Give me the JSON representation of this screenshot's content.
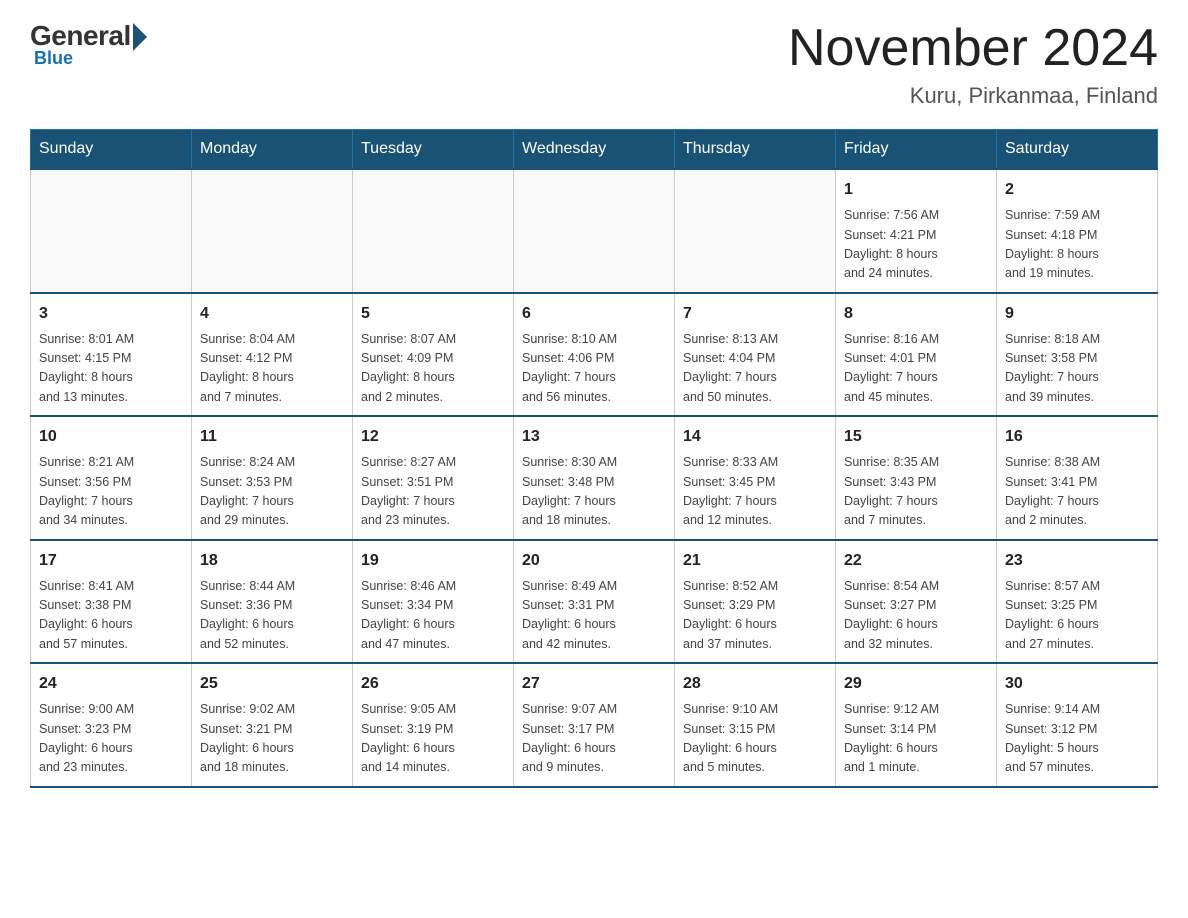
{
  "logo": {
    "general": "General",
    "blue_text": "Blue"
  },
  "header": {
    "month_year": "November 2024",
    "location": "Kuru, Pirkanmaa, Finland"
  },
  "days_of_week": [
    "Sunday",
    "Monday",
    "Tuesday",
    "Wednesday",
    "Thursday",
    "Friday",
    "Saturday"
  ],
  "weeks": [
    [
      {
        "day": "",
        "info": ""
      },
      {
        "day": "",
        "info": ""
      },
      {
        "day": "",
        "info": ""
      },
      {
        "day": "",
        "info": ""
      },
      {
        "day": "",
        "info": ""
      },
      {
        "day": "1",
        "info": "Sunrise: 7:56 AM\nSunset: 4:21 PM\nDaylight: 8 hours\nand 24 minutes."
      },
      {
        "day": "2",
        "info": "Sunrise: 7:59 AM\nSunset: 4:18 PM\nDaylight: 8 hours\nand 19 minutes."
      }
    ],
    [
      {
        "day": "3",
        "info": "Sunrise: 8:01 AM\nSunset: 4:15 PM\nDaylight: 8 hours\nand 13 minutes."
      },
      {
        "day": "4",
        "info": "Sunrise: 8:04 AM\nSunset: 4:12 PM\nDaylight: 8 hours\nand 7 minutes."
      },
      {
        "day": "5",
        "info": "Sunrise: 8:07 AM\nSunset: 4:09 PM\nDaylight: 8 hours\nand 2 minutes."
      },
      {
        "day": "6",
        "info": "Sunrise: 8:10 AM\nSunset: 4:06 PM\nDaylight: 7 hours\nand 56 minutes."
      },
      {
        "day": "7",
        "info": "Sunrise: 8:13 AM\nSunset: 4:04 PM\nDaylight: 7 hours\nand 50 minutes."
      },
      {
        "day": "8",
        "info": "Sunrise: 8:16 AM\nSunset: 4:01 PM\nDaylight: 7 hours\nand 45 minutes."
      },
      {
        "day": "9",
        "info": "Sunrise: 8:18 AM\nSunset: 3:58 PM\nDaylight: 7 hours\nand 39 minutes."
      }
    ],
    [
      {
        "day": "10",
        "info": "Sunrise: 8:21 AM\nSunset: 3:56 PM\nDaylight: 7 hours\nand 34 minutes."
      },
      {
        "day": "11",
        "info": "Sunrise: 8:24 AM\nSunset: 3:53 PM\nDaylight: 7 hours\nand 29 minutes."
      },
      {
        "day": "12",
        "info": "Sunrise: 8:27 AM\nSunset: 3:51 PM\nDaylight: 7 hours\nand 23 minutes."
      },
      {
        "day": "13",
        "info": "Sunrise: 8:30 AM\nSunset: 3:48 PM\nDaylight: 7 hours\nand 18 minutes."
      },
      {
        "day": "14",
        "info": "Sunrise: 8:33 AM\nSunset: 3:45 PM\nDaylight: 7 hours\nand 12 minutes."
      },
      {
        "day": "15",
        "info": "Sunrise: 8:35 AM\nSunset: 3:43 PM\nDaylight: 7 hours\nand 7 minutes."
      },
      {
        "day": "16",
        "info": "Sunrise: 8:38 AM\nSunset: 3:41 PM\nDaylight: 7 hours\nand 2 minutes."
      }
    ],
    [
      {
        "day": "17",
        "info": "Sunrise: 8:41 AM\nSunset: 3:38 PM\nDaylight: 6 hours\nand 57 minutes."
      },
      {
        "day": "18",
        "info": "Sunrise: 8:44 AM\nSunset: 3:36 PM\nDaylight: 6 hours\nand 52 minutes."
      },
      {
        "day": "19",
        "info": "Sunrise: 8:46 AM\nSunset: 3:34 PM\nDaylight: 6 hours\nand 47 minutes."
      },
      {
        "day": "20",
        "info": "Sunrise: 8:49 AM\nSunset: 3:31 PM\nDaylight: 6 hours\nand 42 minutes."
      },
      {
        "day": "21",
        "info": "Sunrise: 8:52 AM\nSunset: 3:29 PM\nDaylight: 6 hours\nand 37 minutes."
      },
      {
        "day": "22",
        "info": "Sunrise: 8:54 AM\nSunset: 3:27 PM\nDaylight: 6 hours\nand 32 minutes."
      },
      {
        "day": "23",
        "info": "Sunrise: 8:57 AM\nSunset: 3:25 PM\nDaylight: 6 hours\nand 27 minutes."
      }
    ],
    [
      {
        "day": "24",
        "info": "Sunrise: 9:00 AM\nSunset: 3:23 PM\nDaylight: 6 hours\nand 23 minutes."
      },
      {
        "day": "25",
        "info": "Sunrise: 9:02 AM\nSunset: 3:21 PM\nDaylight: 6 hours\nand 18 minutes."
      },
      {
        "day": "26",
        "info": "Sunrise: 9:05 AM\nSunset: 3:19 PM\nDaylight: 6 hours\nand 14 minutes."
      },
      {
        "day": "27",
        "info": "Sunrise: 9:07 AM\nSunset: 3:17 PM\nDaylight: 6 hours\nand 9 minutes."
      },
      {
        "day": "28",
        "info": "Sunrise: 9:10 AM\nSunset: 3:15 PM\nDaylight: 6 hours\nand 5 minutes."
      },
      {
        "day": "29",
        "info": "Sunrise: 9:12 AM\nSunset: 3:14 PM\nDaylight: 6 hours\nand 1 minute."
      },
      {
        "day": "30",
        "info": "Sunrise: 9:14 AM\nSunset: 3:12 PM\nDaylight: 5 hours\nand 57 minutes."
      }
    ]
  ]
}
